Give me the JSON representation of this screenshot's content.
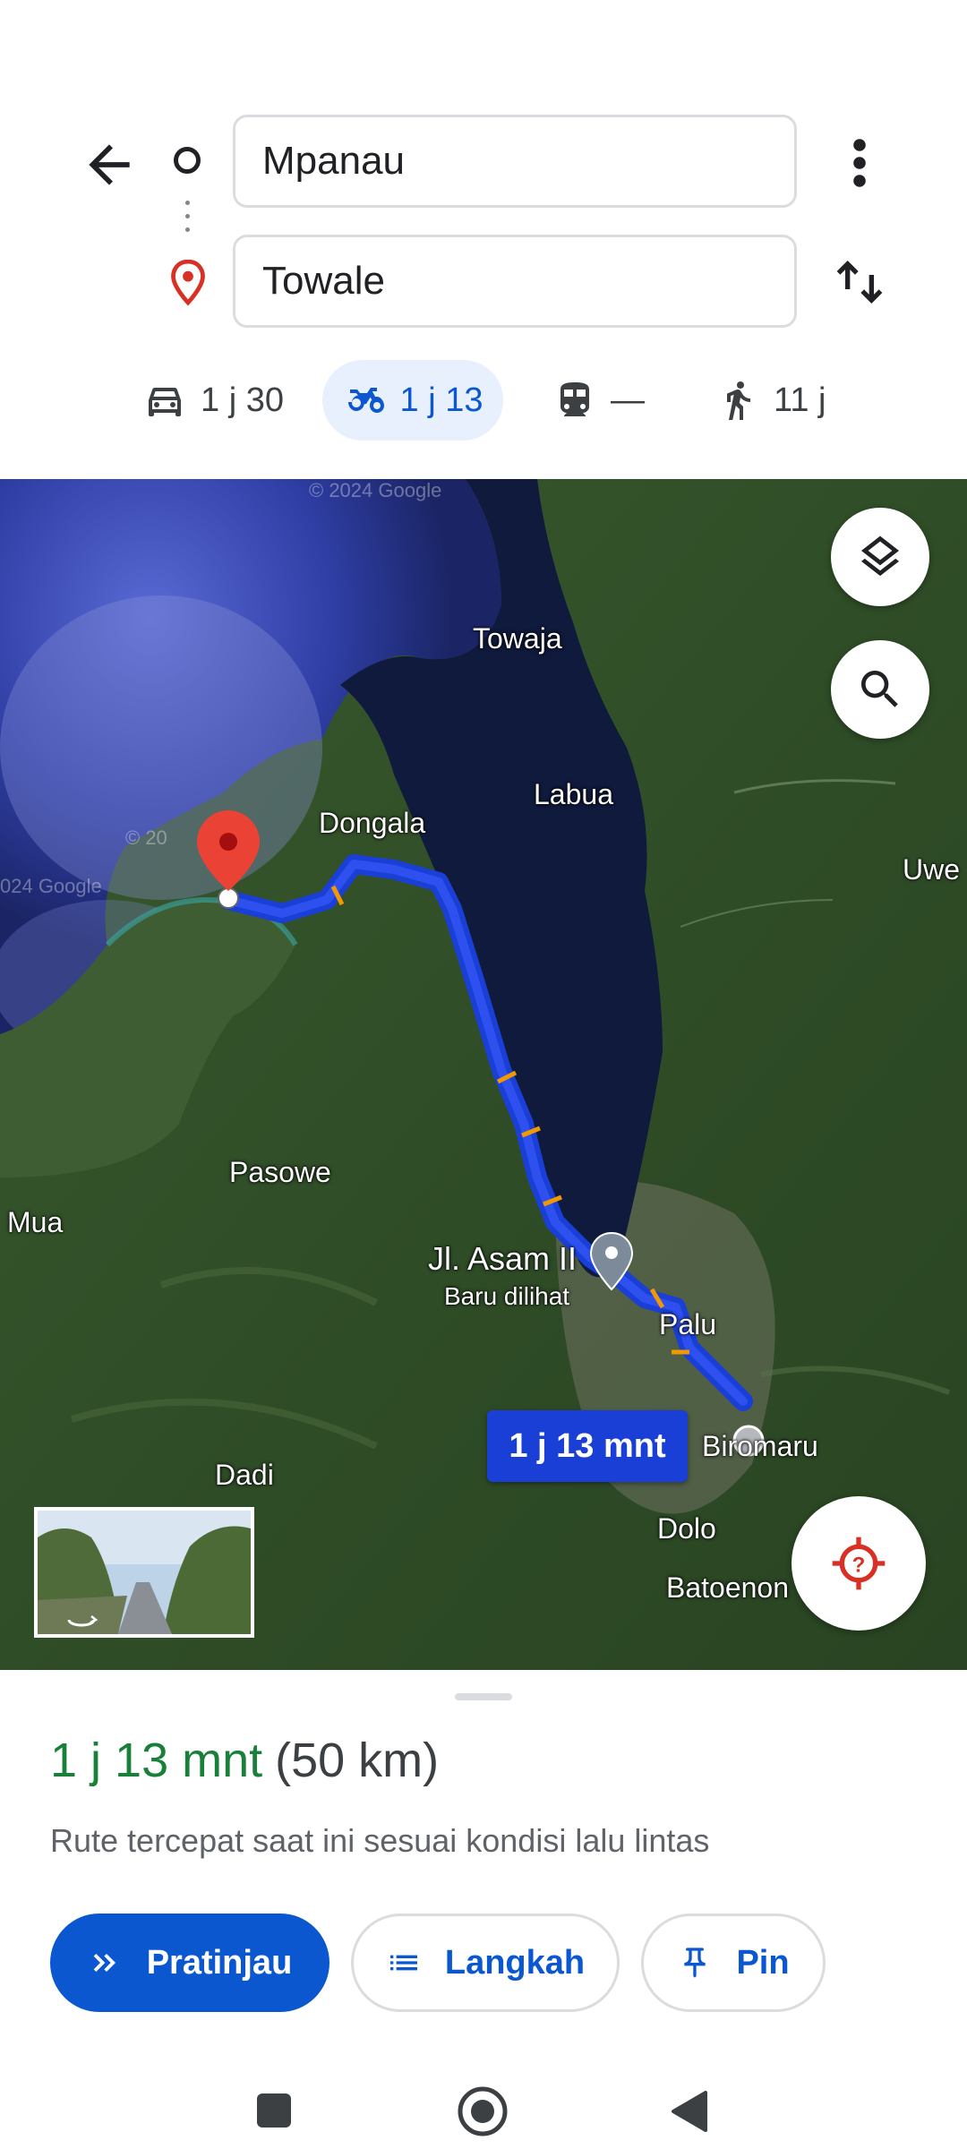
{
  "directions": {
    "origin_value": "Mpanau",
    "destination_value": "Towale"
  },
  "modes": [
    {
      "name": "car",
      "time": "1 j 30",
      "selected": false
    },
    {
      "name": "motorcycle",
      "time": "1 j 13",
      "selected": true
    },
    {
      "name": "transit",
      "time": "—",
      "selected": false
    },
    {
      "name": "walk",
      "time": "11 j",
      "selected": false
    }
  ],
  "map": {
    "labels": {
      "towaja": "Towaja",
      "labua": "Labua",
      "dongala": "Dongala",
      "uwe": "Uwe",
      "pasowe": "Pasowe",
      "mua": "Mua",
      "asam": "Jl. Asam II",
      "recent": "Baru dilihat",
      "palu": "Palu",
      "biromaru": "Biromaru",
      "dadi": "Dadi",
      "dolo": "Dolo",
      "batoenon": "Batoenon"
    },
    "copyright_top": "© 2024 Google",
    "copyright_left": "024 Google",
    "copyright_left2": "© 20",
    "route_duration_chip": "1 j 13 mnt",
    "route_color": "#1a3fd6"
  },
  "sheet": {
    "duration": "1 j 13 mnt",
    "distance": "(50 km)",
    "description": "Rute tercepat saat ini sesuai kondisi lalu lintas",
    "preview_label": "Pratinjau",
    "steps_label": "Langkah",
    "pin_label": "Pin"
  },
  "colors": {
    "accent": "#0b57d0",
    "duration_green": "#188038",
    "destination_red": "#d93025"
  }
}
